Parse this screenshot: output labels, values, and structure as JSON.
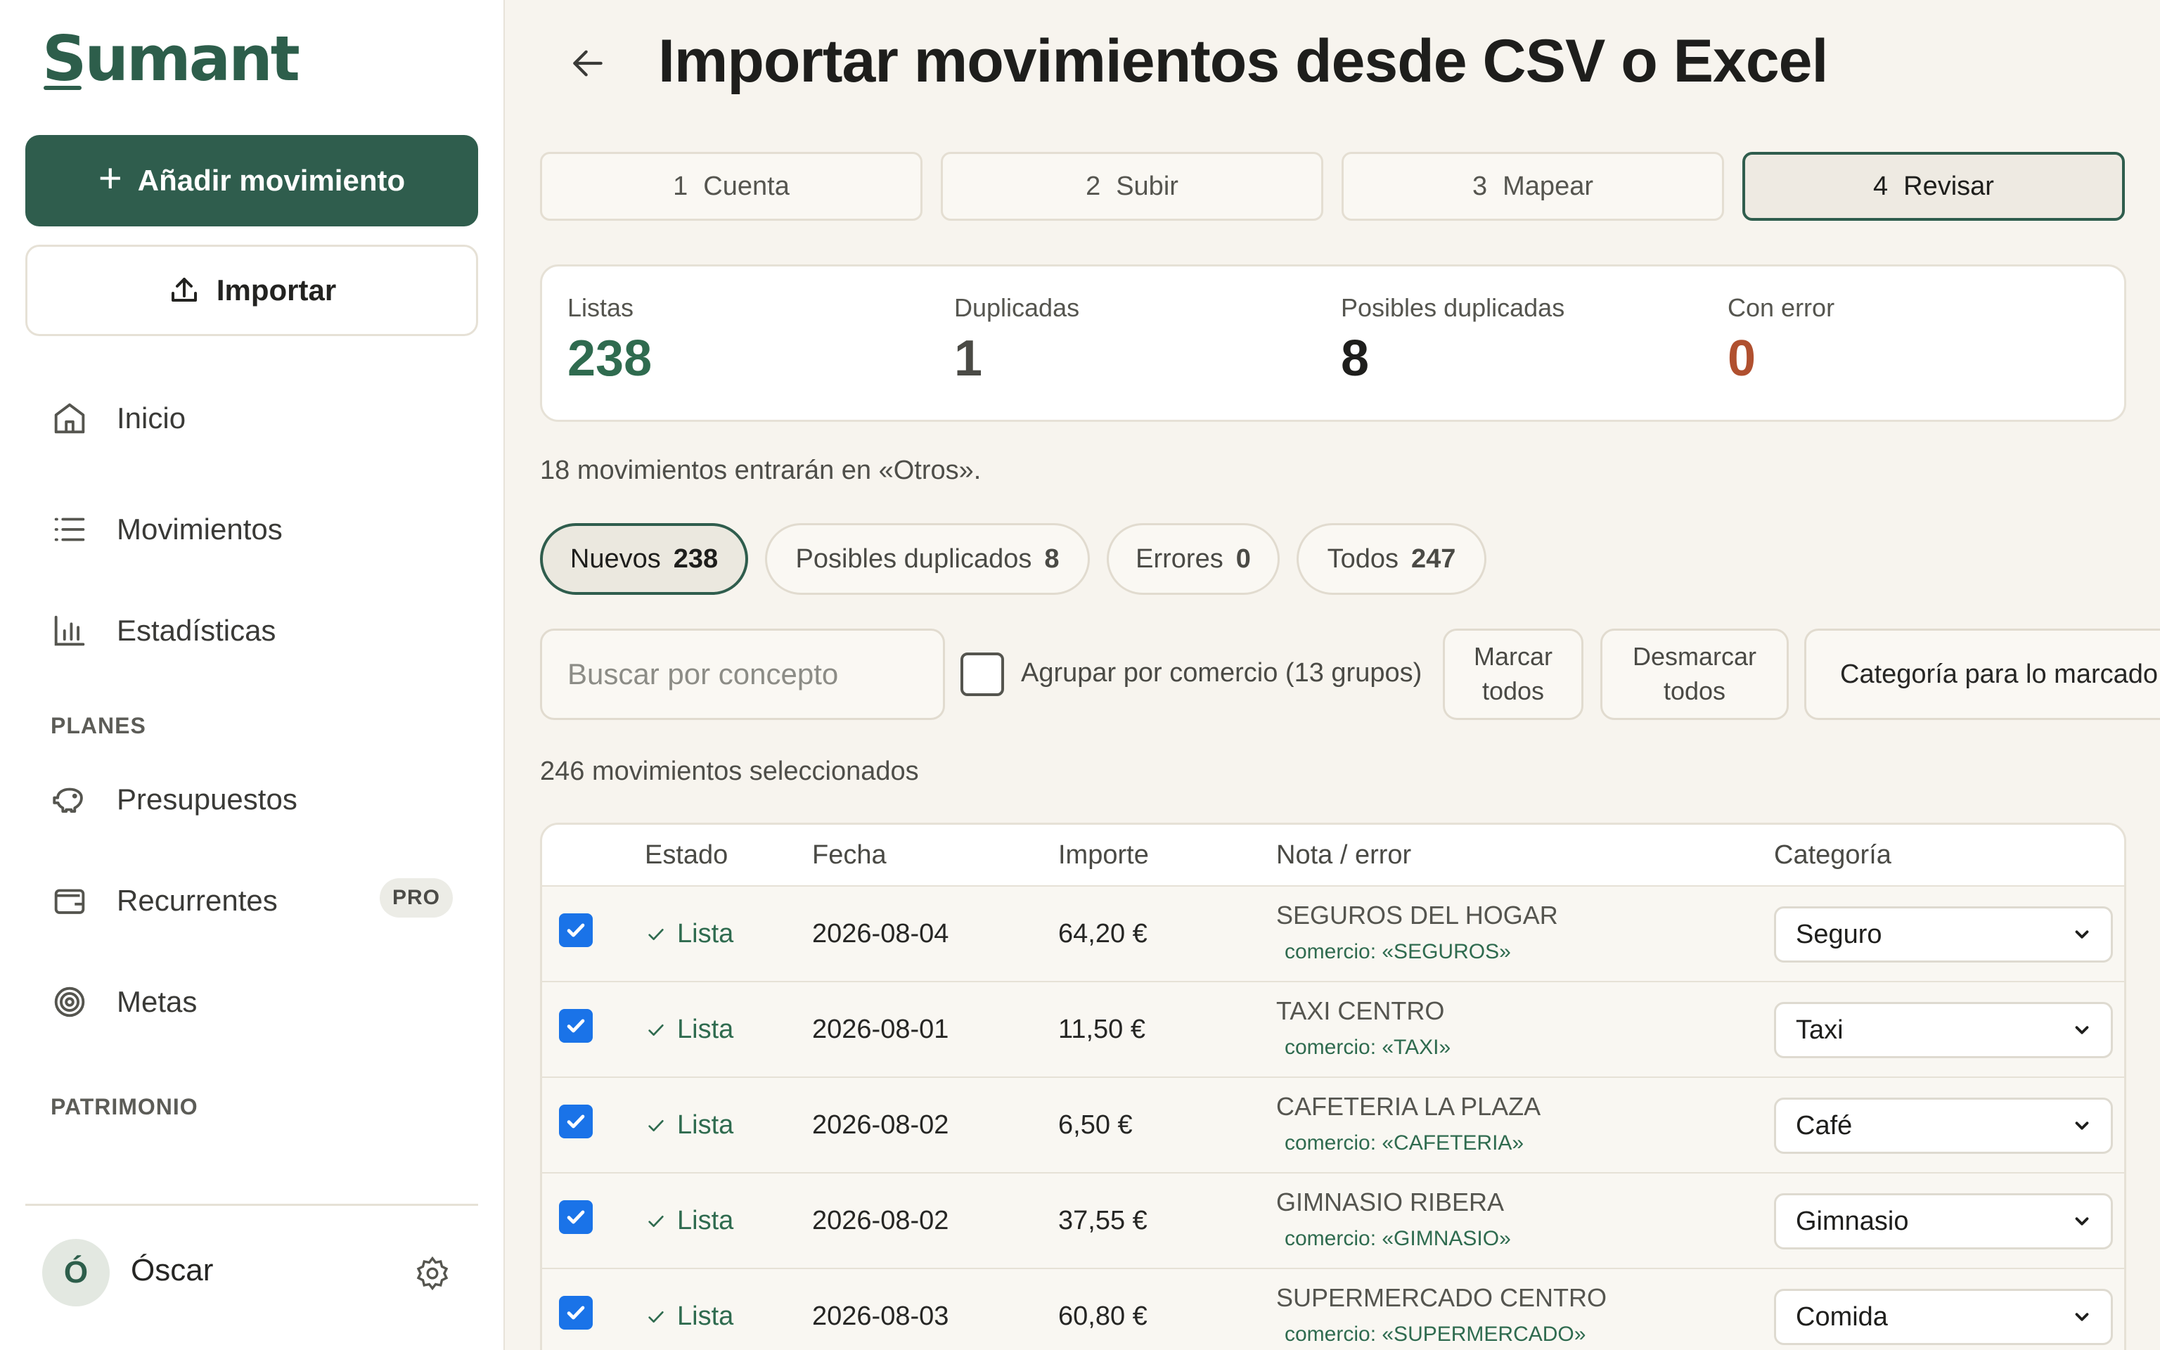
{
  "app": {
    "logo": "Sumant",
    "add_button": "Añadir movimiento",
    "import_button": "Importar",
    "nav": {
      "home": "Inicio",
      "movements": "Movimientos",
      "stats": "Estadísticas",
      "plans_label": "PLANES",
      "budgets": "Presupuestos",
      "recurring": "Recurrentes",
      "recurring_badge": "PRO",
      "goals": "Metas",
      "wealth_label": "PATRIMONIO"
    },
    "user": {
      "initial": "Ó",
      "name": "Óscar"
    }
  },
  "page": {
    "title": "Importar movimientos desde CSV o Excel",
    "steps": [
      {
        "num": "1",
        "label": "Cuenta"
      },
      {
        "num": "2",
        "label": "Subir"
      },
      {
        "num": "3",
        "label": "Mapear"
      },
      {
        "num": "4",
        "label": "Revisar"
      }
    ],
    "stats": [
      {
        "label": "Listas",
        "value": "238",
        "color": "#2f6b4f"
      },
      {
        "label": "Duplicadas",
        "value": "1",
        "color": "#4a4a45"
      },
      {
        "label": "Posibles duplicadas",
        "value": "8",
        "color": "#1e1e1c"
      },
      {
        "label": "Con error",
        "value": "0",
        "color": "#b0502f"
      }
    ],
    "info": "18 movimientos entrarán en «Otros».",
    "filters": [
      {
        "label": "Nuevos",
        "count": "238"
      },
      {
        "label": "Posibles duplicados",
        "count": "8"
      },
      {
        "label": "Errores",
        "count": "0"
      },
      {
        "label": "Todos",
        "count": "247"
      }
    ],
    "search_placeholder": "Buscar por concepto",
    "group_label": "Agrupar por comercio (13 grupos)",
    "mark_all": "Marcar todos",
    "unmark_all": "Desmarcar todos",
    "category_for_marked": "Categoría para lo marcado",
    "selected_count": "246 movimientos seleccionados"
  },
  "table": {
    "headers": {
      "status": "Estado",
      "date": "Fecha",
      "amount": "Importe",
      "note": "Nota / error",
      "category": "Categoría"
    },
    "rows": [
      {
        "status": "Lista",
        "date": "2026-08-04",
        "amount": "64,20 €",
        "note": "SEGUROS DEL HOGAR",
        "merchant": "comercio: «SEGUROS»",
        "category": "Seguro"
      },
      {
        "status": "Lista",
        "date": "2026-08-01",
        "amount": "11,50 €",
        "note": "TAXI CENTRO",
        "merchant": "comercio: «TAXI»",
        "category": "Taxi"
      },
      {
        "status": "Lista",
        "date": "2026-08-02",
        "amount": "6,50 €",
        "note": "CAFETERIA LA PLAZA",
        "merchant": "comercio: «CAFETERIA»",
        "category": "Café"
      },
      {
        "status": "Lista",
        "date": "2026-08-02",
        "amount": "37,55 €",
        "note": "GIMNASIO RIBERA",
        "merchant": "comercio: «GIMNASIO»",
        "category": "Gimnasio"
      },
      {
        "status": "Lista",
        "date": "2026-08-03",
        "amount": "60,80 €",
        "note": "SUPERMERCADO CENTRO",
        "merchant": "comercio: «SUPERMERCADO»",
        "category": "Comida"
      }
    ]
  }
}
